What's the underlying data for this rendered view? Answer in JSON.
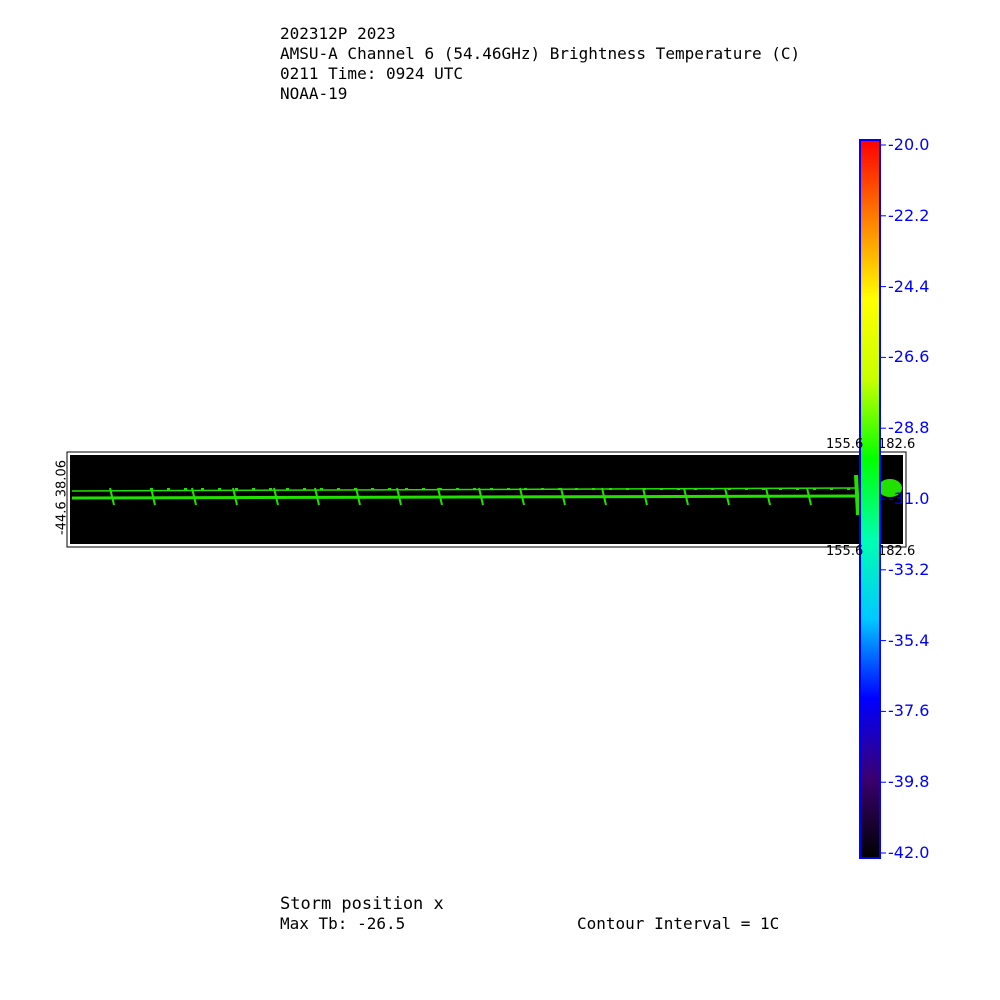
{
  "header": {
    "line1": "202312P 2023",
    "line2": "AMSU-A Channel 6 (54.46GHz) Brightness Temperature (C)",
    "line3": "0211 Time: 0924 UTC",
    "line4": "NOAA-19"
  },
  "footer": {
    "storm_position": "Storm position x",
    "max_tb": "Max Tb: -26.5",
    "contour_interval": "Contour Interval = 1C"
  },
  "axes": {
    "left_label": "-44.6 38.06",
    "top_left": "155.6",
    "top_right": "182.6",
    "bottom_left": "155.6",
    "bottom_right": "182.6"
  },
  "chart_data": {
    "type": "heatmap",
    "title": "AMSU-A Channel 6 (54.46GHz) Brightness Temperature (C)",
    "colorbar": {
      "min": -42.0,
      "max": -20.0,
      "ticks": [
        "-20.0",
        "-22.2",
        "-24.4",
        "-26.6",
        "-28.8",
        "-31.0",
        "-33.2",
        "-35.4",
        "-37.6",
        "-39.8",
        "-42.0"
      ],
      "colors": [
        "#000000",
        "#3a0070",
        "#0000ff",
        "#00c8ff",
        "#00ffb0",
        "#00ff00",
        "#c8ff00",
        "#ffff00",
        "#ff8000",
        "#ff0000"
      ]
    },
    "background_value_color": "#000000",
    "swath_value": -28.0,
    "swath_color": "#22e000"
  }
}
